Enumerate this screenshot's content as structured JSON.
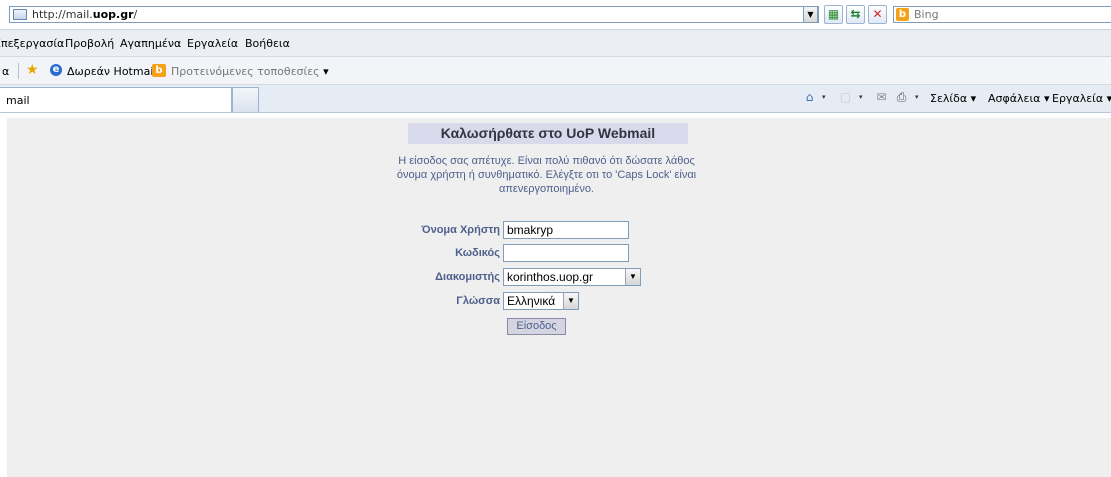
{
  "browser": {
    "url_prefix": "http://mail.",
    "url_host": "uop.gr",
    "url_suffix": "/",
    "search_placeholder": "Bing",
    "bing_letter": "b",
    "dropdown_glyph": "▼"
  },
  "menu": {
    "items": [
      "Επεξεργασία",
      "Προβολή",
      "Αγαπημένα",
      "Εργαλεία",
      "Βοήθεια"
    ]
  },
  "favorites": {
    "left_fragment": "α",
    "hotmail_label": "Δωρεάν Hotmail",
    "suggested_label": "Προτεινόμενες τοποθεσίες",
    "suggested_arrow": "▾"
  },
  "tabs": {
    "current_label": "mail"
  },
  "command_bar": {
    "page_label": "Σελίδα",
    "safety_label": "Ασφάλεια",
    "tools_label": "Εργαλεία",
    "arrow": "▾"
  },
  "page": {
    "title": "Καλωσήρθατε στο UoP Webmail",
    "error_message": "Η είσοδος σας απέτυχε. Είναι πολύ πιθανό ότι δώσατε λάθος όνομα χρήστη ή συνθηματικό. Ελέγξτε οτι το 'Caps Lock' είναι απενεργοποιημένο.",
    "username_label": "Όνομα Χρήστη",
    "username_value": "bmakryp",
    "password_label": "Κωδικός",
    "password_value": "",
    "server_label": "Διακομιστής",
    "server_value": "korinthos.uop.gr",
    "language_label": "Γλώσσα",
    "language_value": "Ελληνικά",
    "login_label": "Είσοδος"
  },
  "colors": {
    "label_text": "#4e5f8c",
    "title_background": "#d9d9ec",
    "page_background": "#efefef"
  }
}
